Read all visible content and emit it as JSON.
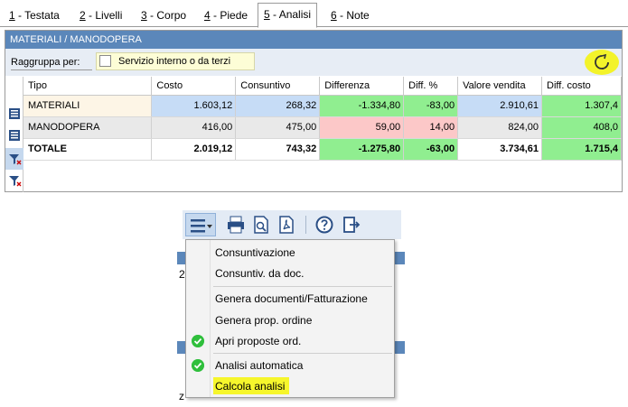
{
  "tabs": [
    {
      "key": "1",
      "label": " - Testata"
    },
    {
      "key": "2",
      "label": " - Livelli"
    },
    {
      "key": "3",
      "label": " - Corpo"
    },
    {
      "key": "4",
      "label": " - Piede"
    },
    {
      "key": "5",
      "label": " - Analisi"
    },
    {
      "key": "6",
      "label": " - Note"
    }
  ],
  "panel": {
    "title": "MATERIALI / MANODOPERA",
    "group_label": "Raggruppa per:",
    "group_option": "Servizio interno o da terzi",
    "group_checked": false,
    "refresh_icon": "refresh-icon"
  },
  "grid": {
    "columns": [
      "Tipo",
      "Costo",
      "Consuntivo",
      "Differenza",
      "Diff. %",
      "Valore vendita",
      "Diff. costo"
    ],
    "rows": [
      {
        "tipo": "MATERIALI",
        "costo": "1.603,12",
        "consuntivo": "268,32",
        "differenza": "-1.334,80",
        "diff_pct": "-83,00",
        "valore_vendita": "2.910,61",
        "diff_costo": "1.307,4"
      },
      {
        "tipo": "MANODOPERA",
        "costo": "416,00",
        "consuntivo": "475,00",
        "differenza": "59,00",
        "diff_pct": "14,00",
        "valore_vendita": "824,00",
        "diff_costo": "408,0"
      },
      {
        "tipo": "TOTALE",
        "costo": "2.019,12",
        "consuntivo": "743,32",
        "differenza": "-1.275,80",
        "diff_pct": "-63,00",
        "valore_vendita": "3.734,61",
        "diff_costo": "1.715,4"
      }
    ],
    "row_icons": [
      "list-icon",
      "list-icon",
      "filter-icon",
      "filter-icon"
    ]
  },
  "toolbar": {
    "icons": [
      "hamburger-menu-icon",
      "printer-icon",
      "print-preview-icon",
      "pdf-icon",
      "help-icon",
      "exit-icon"
    ]
  },
  "background": {
    "frag_1": "2",
    "frag_2": "z"
  },
  "menu": {
    "items": [
      {
        "label": "Consuntivazione",
        "checked": false
      },
      {
        "label": "Consuntiv. da doc.",
        "checked": false
      },
      {
        "label": "Genera documenti/Fatturazione",
        "checked": false
      },
      {
        "label": "Genera prop. ordine",
        "checked": false
      },
      {
        "label": "Apri proposte ord.",
        "checked": true
      },
      {
        "label": "Analisi automatica",
        "checked": true
      },
      {
        "label": "Calcola analisi",
        "checked": false,
        "highlighted": true
      }
    ]
  },
  "colors": {
    "header_blue": "#5b87ba",
    "cell_blue": "#c6dcf6",
    "cell_green": "#90ee90",
    "cell_pink": "#fcc8c8",
    "highlight_yellow": "#f3f32a",
    "check_green": "#2fbf3c"
  }
}
